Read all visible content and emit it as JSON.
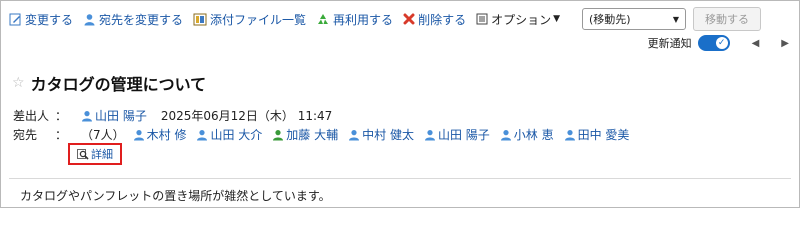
{
  "toolbar": {
    "edit": "変更する",
    "change_recipients": "宛先を変更する",
    "attachments": "添付ファイル一覧",
    "reuse": "再利用する",
    "delete": "削除する",
    "options": "オプション",
    "move_select": "(移動先)",
    "move_button": "移動する"
  },
  "notify": {
    "label": "更新通知",
    "enabled": true
  },
  "message": {
    "title": "カタログの管理について",
    "sender_label": "差出人",
    "separator": "：",
    "sender_name": "山田 陽子",
    "sent_at": "2025年06月12日（木） 11:47",
    "recipients_label": "宛先",
    "recipient_count": "（7人）",
    "recipients": [
      "木村 修",
      "山田 大介",
      "加藤 大輔",
      "中村 健太",
      "山田 陽子",
      "小林 恵",
      "田中 愛美"
    ],
    "detail_label": "詳細",
    "body": "カタログやパンフレットの置き場所が雑然としています。"
  },
  "colors": {
    "link": "#1a57a6",
    "highlight_border": "#e01e1e",
    "toggle": "#1a6fc9"
  }
}
